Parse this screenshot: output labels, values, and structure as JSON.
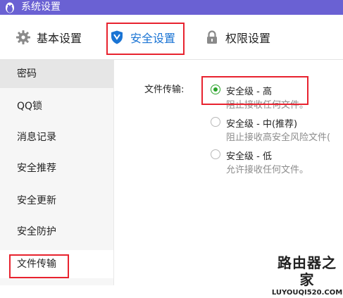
{
  "window": {
    "title": "系统设置",
    "accent": "#6a61d3"
  },
  "tabs": [
    {
      "label": "基本设置",
      "icon": "gear-icon",
      "selected": false
    },
    {
      "label": "安全设置",
      "icon": "shield-icon",
      "selected": true
    },
    {
      "label": "权限设置",
      "icon": "lock-icon",
      "selected": false
    }
  ],
  "sidebar": {
    "items": [
      {
        "label": "密码"
      },
      {
        "label": "QQ锁"
      },
      {
        "label": "消息记录"
      },
      {
        "label": "安全推荐"
      },
      {
        "label": "安全更新"
      },
      {
        "label": "安全防护"
      },
      {
        "label": "文件传输",
        "active": true
      }
    ]
  },
  "file_transfer": {
    "label": "文件传输:",
    "options": [
      {
        "title": "安全级 - 高",
        "desc": "阻止接收任何文件。",
        "checked": true
      },
      {
        "title": "安全级 - 中(推荐)",
        "desc": "阻止接收高安全风险文件(",
        "checked": false
      },
      {
        "title": "安全级 - 低",
        "desc": "允许接收任何文件。",
        "checked": false
      }
    ]
  },
  "watermark": {
    "cn": "路由器之家",
    "en": "LUYOUQI520.COM"
  },
  "highlight_color": "#e8232f"
}
